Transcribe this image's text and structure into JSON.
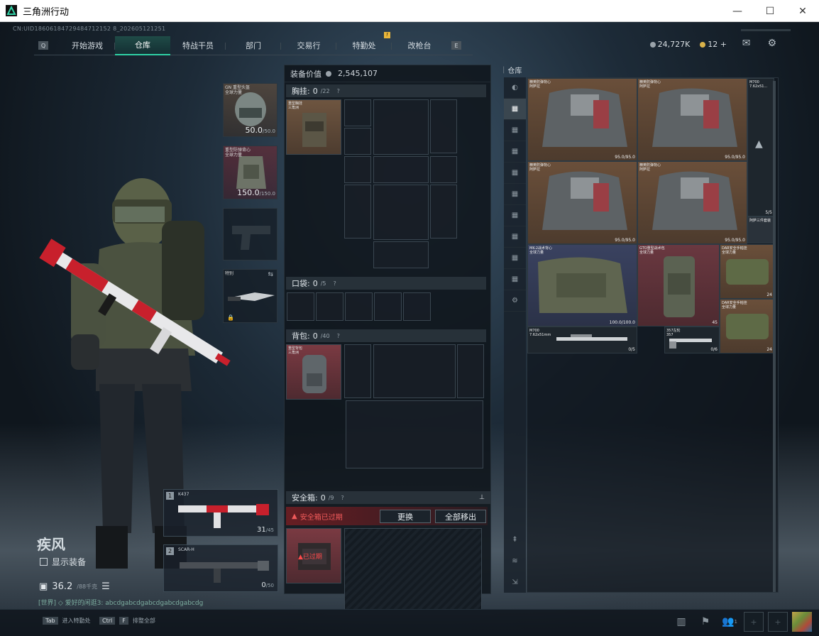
{
  "window": {
    "title": "三角洲行动",
    "min": "—",
    "max": "☐",
    "close": "✕"
  },
  "uid": "CN:UID18606184729484712152 8_202605121251",
  "tabs": {
    "left_key": "Q",
    "right_key": "E",
    "items": [
      "开始游戏",
      "仓库",
      "特战干员",
      "部门",
      "交易行",
      "特勤处",
      "改枪台"
    ],
    "active": "仓库",
    "badge": "!"
  },
  "currency": {
    "havoc": "24,727K",
    "coins": "12",
    "plus": "+"
  },
  "colors": {
    "accent": "#2fd1a5",
    "warning": "#e8473f",
    "badge": "#e8b53a"
  },
  "character": {
    "name": "疾风",
    "show_gear": "显示装备",
    "wealth": "36.2",
    "wealth_unit": "/88千克"
  },
  "chat": "[世界] ◇ 爱好的闲逛3: abcdgabcdgabcdgabcdgabcdg",
  "equipment": {
    "helmet": {
      "name": "GN 重型头盔\n全球力量",
      "dur": "50.0",
      "max": "/50.0"
    },
    "armor": {
      "name": "重型防弹背心\n全球力量",
      "dur": "150.0",
      "max": "/150.0"
    },
    "knife": {
      "name": "特别"
    }
  },
  "weapons": [
    {
      "num": "1",
      "name": "K437",
      "ammo": "31",
      "mag": "/45"
    },
    {
      "num": "2",
      "name": "SCAR-H",
      "ammo": "0",
      "mag": "/50"
    }
  ],
  "middle": {
    "value_label": "装备价值",
    "value": "2,545,107",
    "chest": {
      "label": "胸挂:",
      "count": "0",
      "max": "/22",
      "q": "?",
      "item": "重型胸挂\n三角洲"
    },
    "pocket": {
      "label": "口袋:",
      "count": "0",
      "max": "/5",
      "q": "?"
    },
    "backpack": {
      "label": "背包:",
      "count": "0",
      "max": "/40",
      "q": "?",
      "item": "重型背包\n三角洲"
    },
    "safebox": {
      "label": "安全箱:",
      "count": "0",
      "max": "/9",
      "q": "?",
      "pin": "⊥",
      "expired": "安全箱已过期",
      "replace": "更换",
      "move_all": "全部移出",
      "item_tag": "已过期"
    }
  },
  "warehouse": {
    "title": "仓库",
    "items": [
      {
        "name": "精英防弹背心\n阿萨拉",
        "dur": "95.0/95.0"
      },
      {
        "name": "精英防弹背心\n阿萨拉",
        "dur": "95.0/95.0"
      },
      {
        "name": "精英防弹背心\n阿萨拉",
        "dur": "95.0/95.0"
      },
      {
        "name": "精英防弹背心\n阿萨拉",
        "dur": "95.0/95.0"
      },
      {
        "name": "M700\n7.62x51...",
        "dur": ""
      },
      {
        "name": "MK-2战术背心\n全球力量",
        "dur": "100.0/100.0"
      },
      {
        "name": "GTO重型战术包\n全球力量",
        "dur": "45"
      },
      {
        "name": "DAR安全手帕挂\n全球力量",
        "dur": "24"
      },
      {
        "name": "DAR安全手帕挂\n全球力量",
        "dur": "24"
      },
      {
        "name": "M700\n7.62x51mm",
        "dur": "0/5"
      },
      {
        "name": "357左轮\n357",
        "dur": "0/6"
      },
      {
        "name": "阿萨三件套装",
        "dur": "5/5"
      }
    ]
  },
  "bottom": {
    "tab_key": "Tab",
    "tab_label": "进入特勤处",
    "ctrl_key": "Ctrl",
    "f_key": "F",
    "ctrl_label": "排整全部",
    "friends": "1"
  }
}
